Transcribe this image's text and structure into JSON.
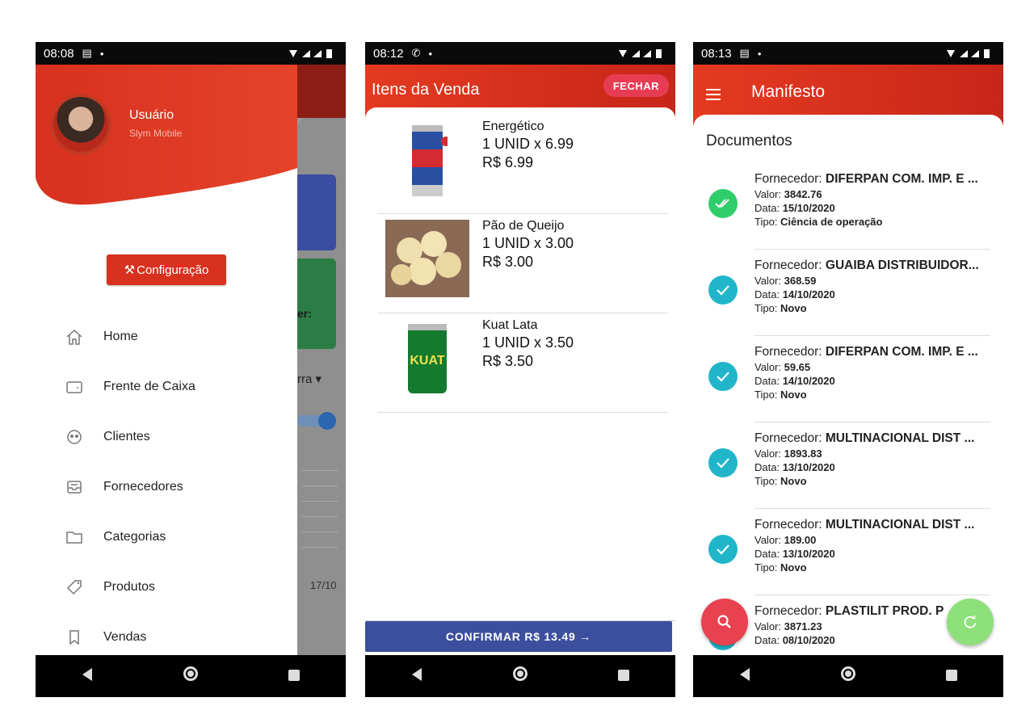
{
  "phone1": {
    "status": {
      "time": "08:08"
    },
    "user": {
      "name": "Usuário",
      "company": "Slym Mobile"
    },
    "config_label": "Configuração",
    "menu": [
      {
        "label": "Home",
        "icon": "home-icon"
      },
      {
        "label": "Frente de Caixa",
        "icon": "wallet-icon"
      },
      {
        "label": "Clientes",
        "icon": "clients-icon"
      },
      {
        "label": "Fornecedores",
        "icon": "inbox-icon"
      },
      {
        "label": "Categorias",
        "icon": "folder-icon"
      },
      {
        "label": "Produtos",
        "icon": "tag-icon"
      },
      {
        "label": "Vendas",
        "icon": "bookmark-icon"
      }
    ],
    "background": {
      "partial_label": "er:",
      "dropdown_partial": "rra",
      "date": "17/10"
    }
  },
  "phone2": {
    "status": {
      "time": "08:12"
    },
    "title": "Itens da Venda",
    "close_label": "FECHAR",
    "items": [
      {
        "name": "Energético",
        "qty": "1 UNID x 6.99",
        "price": "R$ 6.99",
        "image": "energy-drink-can"
      },
      {
        "name": "Pão de Queijo",
        "qty": "1 UNID x 3.00",
        "price": "R$ 3.00",
        "image": "cheese-bread-photo"
      },
      {
        "name": "Kuat Lata",
        "qty": "1 UNID x 3.50",
        "price": "R$ 3.50",
        "image": "soda-can"
      }
    ],
    "confirm_label": "CONFIRMAR R$ 13.49 →"
  },
  "phone3": {
    "status": {
      "time": "08:13"
    },
    "title": "Manifesto",
    "section_title": "Documentos",
    "labels": {
      "supplier": "Fornecedor: ",
      "value": "Valor: ",
      "date": "Data: ",
      "type": "Tipo: "
    },
    "docs": [
      {
        "supplier": "DIFERPAN COM. IMP. E ...",
        "value": "3842.76",
        "date": "15/10/2020",
        "type": "Ciência de operação",
        "status_color": "#2fce6b"
      },
      {
        "supplier": "GUAIBA DISTRIBUIDOR...",
        "value": "368.59",
        "date": "14/10/2020",
        "type": "Novo",
        "status_color": "#21b5c9"
      },
      {
        "supplier": "DIFERPAN COM. IMP. E ...",
        "value": "59.65",
        "date": "14/10/2020",
        "type": "Novo",
        "status_color": "#21b5c9"
      },
      {
        "supplier": "MULTINACIONAL DIST ...",
        "value": "1893.83",
        "date": "13/10/2020",
        "type": "Novo",
        "status_color": "#21b5c9"
      },
      {
        "supplier": "MULTINACIONAL DIST ...",
        "value": "189.00",
        "date": "13/10/2020",
        "type": "Novo",
        "status_color": "#21b5c9"
      },
      {
        "supplier": "PLASTILIT PROD. P",
        "value": "3871.23",
        "date": "08/10/2020",
        "type": "",
        "status_color": "#21b5c9"
      }
    ]
  },
  "colors": {
    "primary_red": "#e43a20",
    "confirm_blue": "#3c4f9e",
    "fab_red": "#e8414f",
    "fab_green": "#8de07a"
  }
}
